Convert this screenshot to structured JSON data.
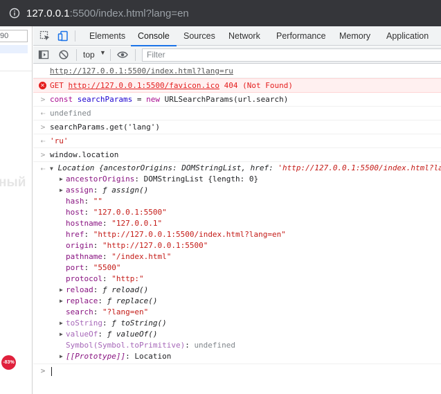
{
  "browser": {
    "url_host": "127.0.0.1",
    "url_rest": ":5500/index.html?lang=en"
  },
  "page": {
    "input_value": "90",
    "heading_fragment": "ный",
    "badge": "-83%"
  },
  "devtools": {
    "tabs": [
      "Elements",
      "Console",
      "Sources",
      "Network",
      "Performance",
      "Memory",
      "Application"
    ],
    "active_tab": "Console",
    "context": "top",
    "filter_placeholder": "Filter"
  },
  "console": {
    "line1_link": "http://127.0.0.1:5500/index.html?lang=ru",
    "error_method": "GET",
    "error_link": "http://127.0.0.1:5500/favicon.ico",
    "error_status": "404 (Not Found)",
    "cmd1_const": "const",
    "cmd1_name": "searchParams",
    "cmd1_eq": "=",
    "cmd1_new": "new",
    "cmd1_rest": "URLSearchParams(url.search)",
    "res1": "undefined",
    "cmd2": "searchParams.get('lang')",
    "res2": "'ru'",
    "cmd3": "window.location",
    "location_summary_a": "Location {ancestorOrigins: DOMStringList, href: ",
    "location_summary_b": "'http://127.0.0.1:5500/index.html?la",
    "props": [
      {
        "key": "ancestorOrigins",
        "val": "DOMStringList {length: 0}"
      },
      {
        "key": "assign",
        "val": "ƒ assign()"
      },
      {
        "key": "hash",
        "val": "\"\""
      },
      {
        "key": "host",
        "val": "\"127.0.0.1:5500\""
      },
      {
        "key": "hostname",
        "val": "\"127.0.0.1\""
      },
      {
        "key": "href",
        "val": "\"http://127.0.0.1:5500/index.html?lang=en\""
      },
      {
        "key": "origin",
        "val": "\"http://127.0.0.1:5500\""
      },
      {
        "key": "pathname",
        "val": "\"/index.html\""
      },
      {
        "key": "port",
        "val": "\"5500\""
      },
      {
        "key": "protocol",
        "val": "\"http:\""
      },
      {
        "key": "reload",
        "val": "ƒ reload()"
      },
      {
        "key": "replace",
        "val": "ƒ replace()"
      },
      {
        "key": "search",
        "val": "\"?lang=en\""
      },
      {
        "key": "toString",
        "val": "ƒ toString()"
      },
      {
        "key": "valueOf",
        "val": "ƒ valueOf()"
      },
      {
        "key": "Symbol(Symbol.toPrimitive)",
        "val": "undefined"
      },
      {
        "key": "[[Prototype]]",
        "val": "Location"
      }
    ]
  }
}
